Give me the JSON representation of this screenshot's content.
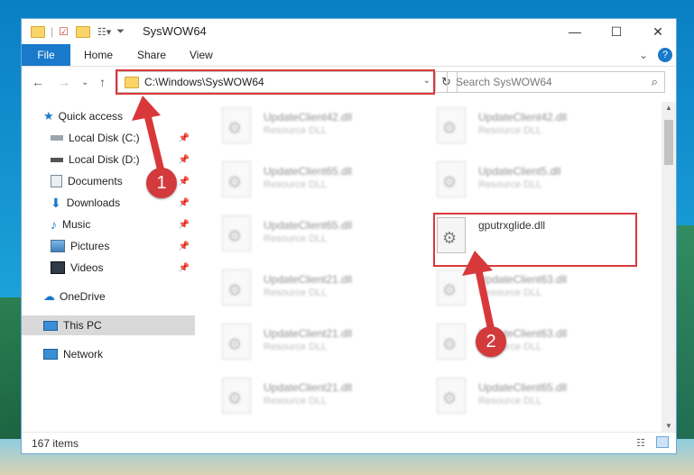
{
  "window": {
    "title": "SysWOW64"
  },
  "ribbon": {
    "tabs": [
      "File",
      "Home",
      "Share",
      "View"
    ]
  },
  "address": {
    "path": "C:\\Windows\\SysWOW64"
  },
  "search": {
    "placeholder": "Search SysWOW64"
  },
  "sidebar": {
    "quick_access": "Quick access",
    "items": [
      "Local Disk (C:)",
      "Local Disk (D:)",
      "Documents",
      "Downloads",
      "Music",
      "Pictures",
      "Videos"
    ],
    "onedrive": "OneDrive",
    "thispc": "This PC",
    "network": "Network"
  },
  "files": [
    {
      "name": "UpdateClient42.dll",
      "type": "Resource DLL"
    },
    {
      "name": "UpdateClient42.dll",
      "type": "Resource DLL"
    },
    {
      "name": "UpdateClient65.dll",
      "type": "Resource DLL"
    },
    {
      "name": "UpdateClient5.dll",
      "type": "Resource DLL"
    },
    {
      "name": "UpdateClient65.dll",
      "type": "Resource DLL"
    },
    {
      "name": "gputrxglide.dll",
      "type": ""
    },
    {
      "name": "UpdateClient21.dll",
      "type": "Resource DLL"
    },
    {
      "name": "UpdateClient63.dll",
      "type": "Resource DLL"
    },
    {
      "name": "UpdateClient21.dll",
      "type": "Resource DLL"
    },
    {
      "name": "UpdateClient63.dll",
      "type": "Resource DLL"
    },
    {
      "name": "UpdateClient21.dll",
      "type": "Resource DLL"
    },
    {
      "name": "UpdateClient65.dll",
      "type": "Resource DLL"
    }
  ],
  "status": {
    "count": "167 items"
  },
  "badges": [
    "1",
    "2"
  ],
  "colors": {
    "accent": "#1979ca",
    "highlight": "#d9383a"
  }
}
